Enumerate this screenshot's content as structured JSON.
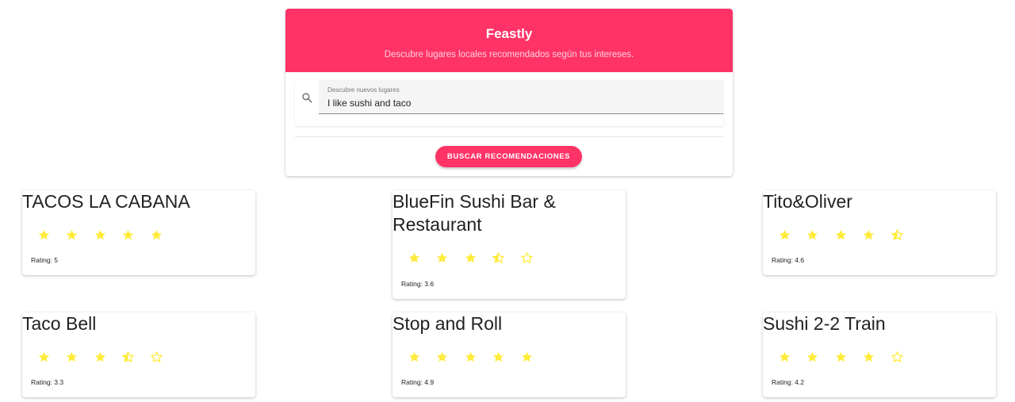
{
  "header": {
    "title": "Feastly",
    "subtitle": "Descubre lugares locales recomendados según tus intereses."
  },
  "search": {
    "label": "Descubre nuevos lugares",
    "value": "I like sushi and taco",
    "icon": "search-icon"
  },
  "actions": {
    "search_label": "BUSCAR RECOMENDACIONES"
  },
  "colors": {
    "accent": "#ff3366",
    "star": "#ffeb3b"
  },
  "results": [
    {
      "name": "TACOS LA CABANA",
      "rating": 5,
      "rating_text": "Rating: 5"
    },
    {
      "name": "BlueFin Sushi Bar & Restaurant",
      "rating": 3.6,
      "rating_text": "Rating: 3.6"
    },
    {
      "name": "Tito&Oliver",
      "rating": 4.6,
      "rating_text": "Rating: 4.6"
    },
    {
      "name": "Taco Bell",
      "rating": 3.3,
      "rating_text": "Rating: 3.3"
    },
    {
      "name": "Stop and Roll",
      "rating": 4.9,
      "rating_text": "Rating: 4.9"
    },
    {
      "name": "Sushi 2-2 Train",
      "rating": 4.2,
      "rating_text": "Rating: 4.2"
    }
  ]
}
